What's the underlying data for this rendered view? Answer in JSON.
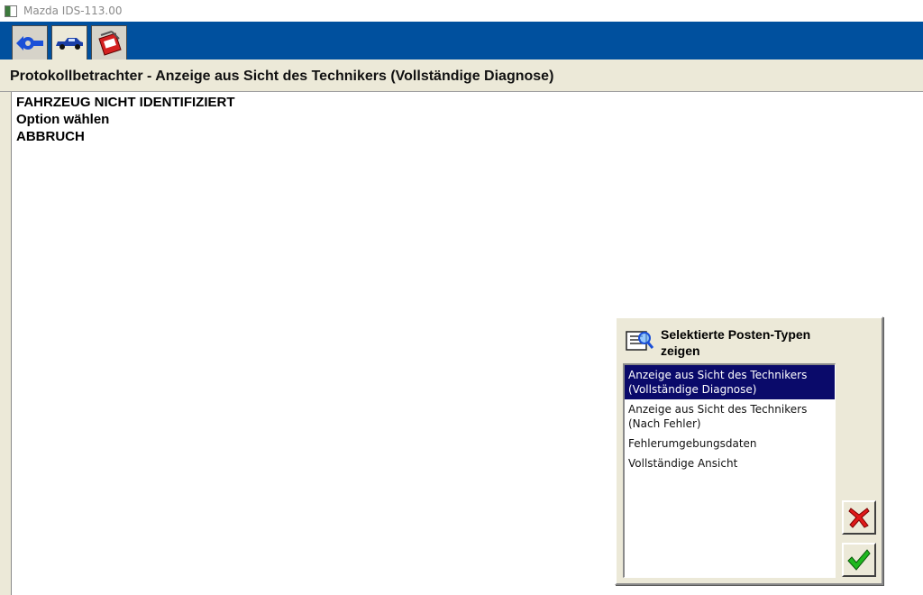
{
  "window": {
    "title": "Mazda IDS-113.00"
  },
  "toolbar": {
    "tabs": [
      {
        "icon": "back-arrow-icon",
        "active": false
      },
      {
        "icon": "vehicle-icon",
        "active": true
      },
      {
        "icon": "toolbox-icon",
        "active": false
      }
    ],
    "colors": {
      "bar": "#00509e",
      "accent": "#0a0a6a"
    }
  },
  "page": {
    "heading": "Protokollbetrachter - Anzeige aus Sicht des Technikers (Vollständige Diagnose)"
  },
  "log": {
    "lines": [
      "FAHRZEUG NICHT IDENTIFIZIERT",
      "Option wählen",
      "ABBRUCH"
    ]
  },
  "dialog": {
    "title": "Selektierte Posten-Typen zeigen",
    "icon": "document-magnifier-icon",
    "options": [
      {
        "label": "Anzeige aus Sicht des Technikers (Vollständige Diagnose)",
        "selected": true
      },
      {
        "label": "Anzeige aus Sicht des Technikers (Nach Fehler)",
        "selected": false
      },
      {
        "label": "Fehlerumgebungsdaten",
        "selected": false
      },
      {
        "label": "Vollständige Ansicht",
        "selected": false
      }
    ],
    "buttons": {
      "cancel_icon": "red-x-icon",
      "ok_icon": "green-check-icon"
    }
  }
}
